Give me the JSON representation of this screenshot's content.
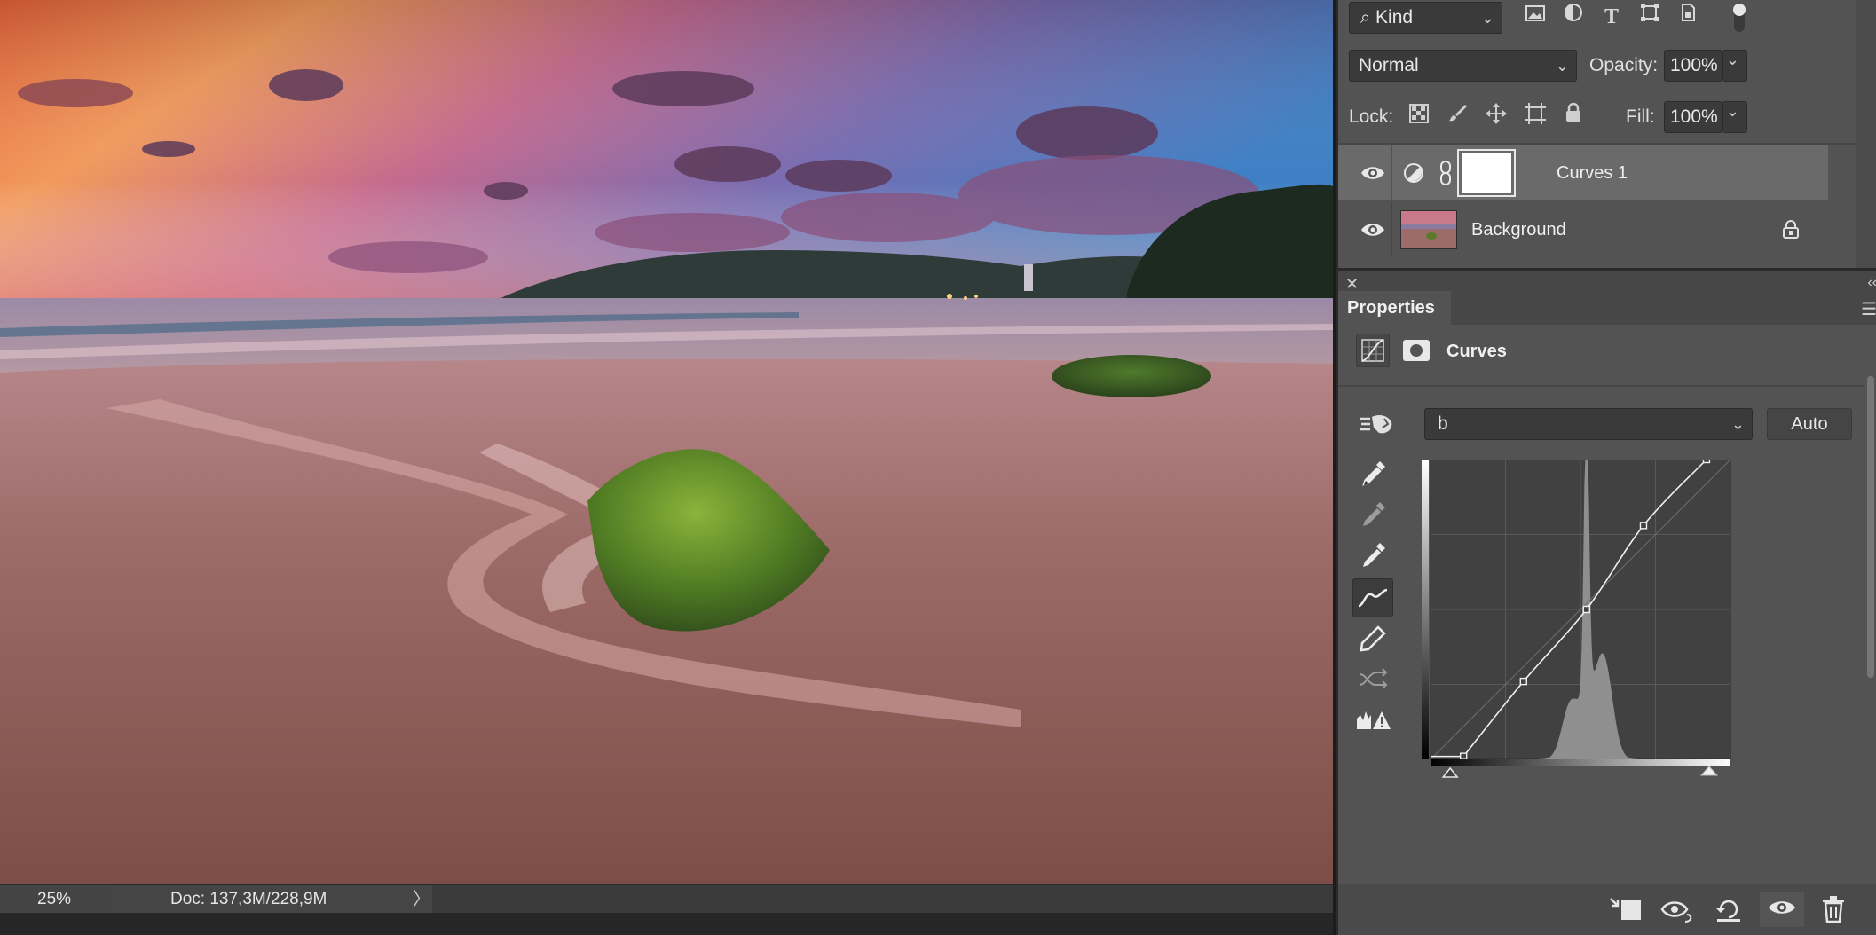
{
  "layers_panel": {
    "filter_kind": "Kind",
    "blend_mode": "Normal",
    "opacity_label": "Opacity:",
    "opacity_value": "100%",
    "lock_label": "Lock:",
    "fill_label": "Fill:",
    "fill_value": "100%",
    "layers": [
      {
        "name": "Curves 1",
        "visible": true,
        "selected": true,
        "type": "adjustment-curves"
      },
      {
        "name": "Background",
        "visible": true,
        "selected": false,
        "locked": true,
        "type": "pixel"
      }
    ]
  },
  "properties_panel": {
    "tab_label": "Properties",
    "adjustment_title": "Curves",
    "channel": "b",
    "auto_label": "Auto",
    "curve_points": [
      {
        "input": 0.11,
        "output": 0.01
      },
      {
        "input": 0.31,
        "output": 0.26
      },
      {
        "input": 0.52,
        "output": 0.5
      },
      {
        "input": 0.71,
        "output": 0.78
      },
      {
        "input": 0.92,
        "output": 1.0
      }
    ],
    "histogram_peak_input": 0.52
  },
  "status_bar": {
    "zoom": "25%",
    "doc_info": "Doc: 137,3M/228,9M",
    "arrow": "〉"
  },
  "colors": {
    "panel_bg": "#535353",
    "selected_layer": "#6a6a6a",
    "field_bg": "#3a3a3a"
  }
}
